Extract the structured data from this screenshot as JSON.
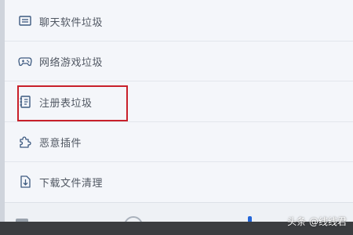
{
  "menu": {
    "items": [
      {
        "label": "聊天软件垃圾",
        "icon": "chat-window-icon"
      },
      {
        "label": "网络游戏垃圾",
        "icon": "gamepad-icon"
      },
      {
        "label": "注册表垃圾",
        "icon": "registry-document-icon"
      },
      {
        "label": "恶意插件",
        "icon": "puzzle-plugin-icon"
      },
      {
        "label": "下载文件清理",
        "icon": "download-file-icon"
      }
    ],
    "highlighted_index": 2
  },
  "watermark": {
    "text": "头条 @线线君"
  },
  "colors": {
    "panel_bg": "#f4f6fa",
    "label": "#505762",
    "highlight_border": "#c8202a",
    "icon_stroke": "#3d5a80",
    "footer": "#3b3d40"
  }
}
